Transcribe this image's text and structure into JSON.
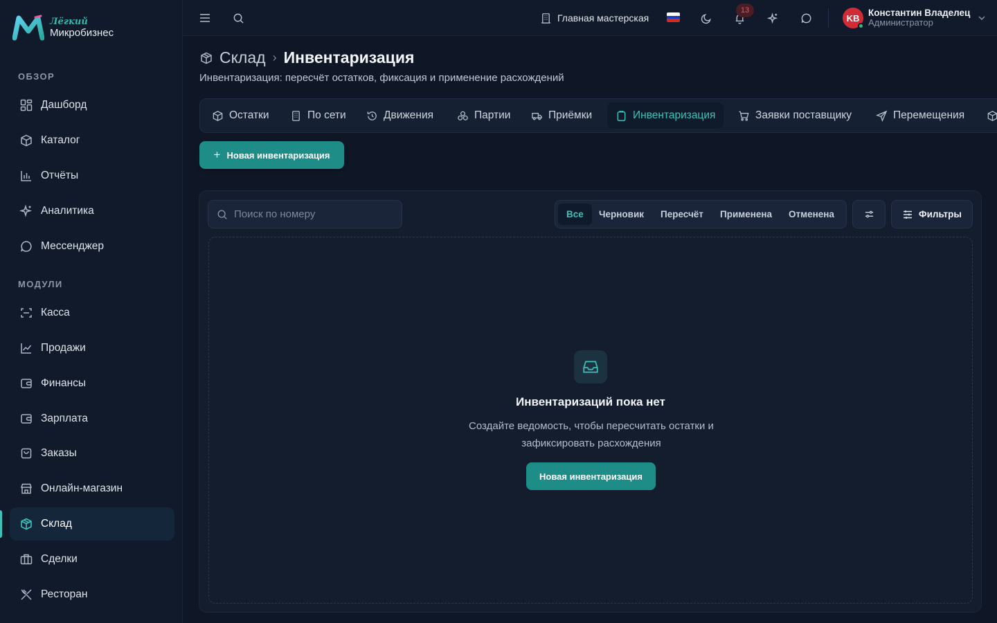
{
  "brand": {
    "line1": "Лёгкий",
    "line2": "Микробизнес"
  },
  "sidebar": {
    "sections": [
      {
        "title": "ОБЗОР",
        "items": [
          {
            "label": "Дашборд",
            "icon": "dashboard-icon"
          },
          {
            "label": "Каталог",
            "icon": "catalog-icon"
          },
          {
            "label": "Отчёты",
            "icon": "reports-icon"
          },
          {
            "label": "Аналитика",
            "icon": "sparkles-icon"
          },
          {
            "label": "Мессенджер",
            "icon": "chat-icon"
          }
        ]
      },
      {
        "title": "МОДУЛИ",
        "items": [
          {
            "label": "Касса",
            "icon": "scan-icon"
          },
          {
            "label": "Продажи",
            "icon": "chart-line-icon"
          },
          {
            "label": "Финансы",
            "icon": "wallet-icon"
          },
          {
            "label": "Зарплата",
            "icon": "wallet-icon"
          },
          {
            "label": "Заказы",
            "icon": "shopping-bag-icon"
          },
          {
            "label": "Онлайн-магазин",
            "icon": "store-icon"
          },
          {
            "label": "Склад",
            "icon": "box-icon",
            "active": true
          },
          {
            "label": "Сделки",
            "icon": "briefcase-icon"
          },
          {
            "label": "Ресторан",
            "icon": "utensils-icon"
          }
        ]
      }
    ]
  },
  "topbar": {
    "workshop": "Главная мастерская",
    "notifications_count": "13",
    "user": {
      "initials": "KB",
      "name": "Константин Владелец",
      "role": "Администратор"
    },
    "flag_colors": [
      "#ffffff",
      "#1c3fbf",
      "#d52b1e"
    ]
  },
  "page": {
    "parent": "Склад",
    "title": "Инвентаризация",
    "subtitle": "Инвентаризация: пересчёт остатков, фиксация и применение расхождений",
    "tabs": [
      {
        "label": "Остатки",
        "icon": "boxes-icon"
      },
      {
        "label": "По сети",
        "icon": "building-icon"
      },
      {
        "label": "Движения",
        "icon": "history-icon"
      },
      {
        "label": "Партии",
        "icon": "layers-icon"
      },
      {
        "label": "Приёмки",
        "icon": "truck-icon"
      },
      {
        "label": "Инвентаризация",
        "icon": "clipboard-icon",
        "active": true
      },
      {
        "label": "Заявки поставщику",
        "icon": "cart-icon"
      },
      {
        "label": "Перемещения",
        "icon": "send-icon"
      }
    ],
    "new_button": "Новая инвентаризация"
  },
  "list": {
    "search_placeholder": "Поиск по номеру",
    "status_filters": [
      "Все",
      "Черновик",
      "Пересчёт",
      "Применена",
      "Отменена"
    ],
    "active_status": "Все",
    "filters_label": "Фильтры"
  },
  "empty_state": {
    "title": "Инвентаризаций пока нет",
    "text": "Создайте ведомость, чтобы пересчитать остатки и зафиксировать расхождения",
    "button": "Новая инвентаризация"
  },
  "colors": {
    "accent": "#3cc3b9",
    "primary_button": "#1f8d87",
    "background": "#0f1726",
    "badge": "#e45a66"
  }
}
